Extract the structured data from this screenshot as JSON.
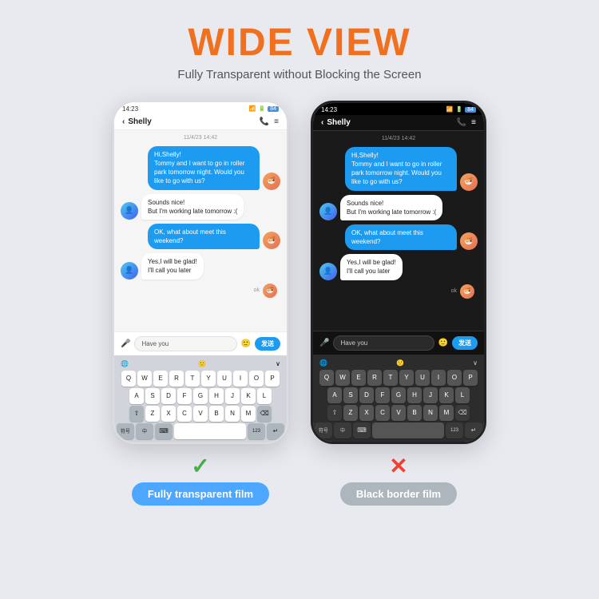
{
  "header": {
    "title": "WIDE VIEW",
    "subtitle": "Fully Transparent without Blocking the Screen"
  },
  "phone_left": {
    "type": "transparent",
    "status_time": "14:23",
    "status_icons": "📶 🔋",
    "contact": "Shelly",
    "date_label": "11/4/23 14:42",
    "messages": [
      {
        "sender": "right",
        "text": "Hi,Shelly!\nTommy and I want to go in roller park tomorrow night. Would you like to go with us?",
        "type": "blue"
      },
      {
        "sender": "left",
        "text": "Sounds nice!\nBut I'm working late tomorrow :(",
        "type": "white"
      },
      {
        "sender": "right",
        "text": "OK, what about meet this weekend?",
        "type": "blue"
      },
      {
        "sender": "left",
        "text": "Yes,I will be glad!\nI'll call you later",
        "type": "white"
      }
    ],
    "input_text": "Have you",
    "send_label": "发送",
    "keyboard_rows": [
      [
        "Q",
        "W",
        "E",
        "R",
        "T",
        "Y",
        "U",
        "I",
        "O",
        "P"
      ],
      [
        "A",
        "S",
        "D",
        "F",
        "G",
        "H",
        "J",
        "K",
        "L"
      ],
      [
        "Z",
        "X",
        "C",
        "V",
        "B",
        "N",
        "M"
      ]
    ],
    "bottom_keys": [
      "符号",
      "中",
      "⌨",
      "123",
      "↵"
    ]
  },
  "phone_right": {
    "type": "black_border",
    "status_time": "14:23",
    "contact": "Shelly",
    "date_label": "11/4/23 14:42"
  },
  "labels": {
    "left_check": "✓",
    "left_label": "Fully transparent film",
    "right_cross": "✕",
    "right_label": "Black border film"
  }
}
